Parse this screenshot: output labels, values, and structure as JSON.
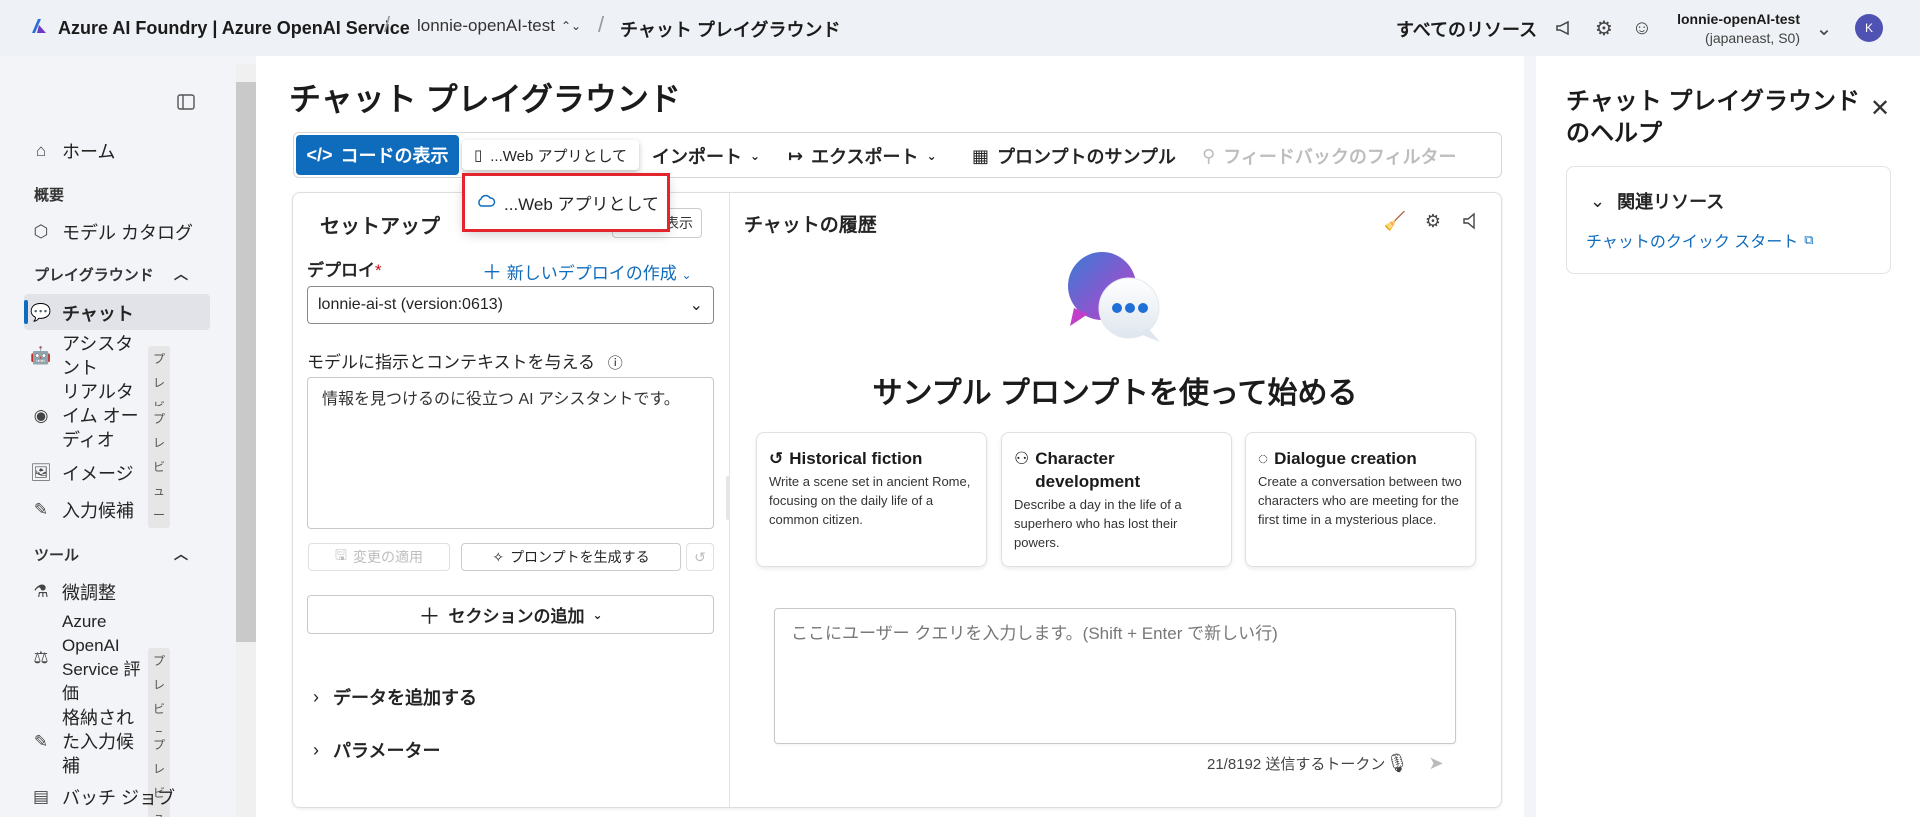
{
  "topbar": {
    "brand": "Azure AI Foundry | Azure OpenAI Service",
    "project": "lonnie-openAI-test",
    "page": "チャット プレイグラウンド",
    "all_resources": "すべてのリソース",
    "account_name": "lonnie-openAI-test",
    "account_region": "(japaneast, S0)",
    "avatar_initial": "K"
  },
  "sidebar": {
    "home": "ホーム",
    "overview_section": "概要",
    "model_catalog": "モデル カタログ",
    "playground_section": "プレイグラウンド",
    "chat": "チャット",
    "assistant": "アシスタ\nント",
    "realtime_audio": "リアルタ\nイム オー\nディオ",
    "image": "イメージ",
    "completions": "入力候補",
    "tools_section": "ツール",
    "fine_tuning": "微調整",
    "evaluation": "Azure\nOpenAI\nService 評\n価",
    "stored_completions": "格納され\nた入力候\n補",
    "batch_jobs": "バッチ ジョブ",
    "preview_badge": "プレビュー"
  },
  "main": {
    "title": "チャット プレイグラウンド",
    "toolbar": {
      "view_code": "コードの表示",
      "deploy_tip": "...Web アプリとして",
      "import": "インポート",
      "export": "エクスポート",
      "prompt_samples": "プロンプトのサンプル",
      "feedback_filter": "フィードバックのフィルター"
    },
    "dropdown_item": "...Web アプリとして",
    "setup": {
      "title": "セットアップ",
      "show_btn": "表示",
      "deploy_label": "デプロイ",
      "required": "*",
      "new_deploy": "新しいデプロイの作成",
      "deploy_value": "lonnie-ai-st (version:0613)",
      "instruct_label": "モデルに指示とコンテキストを与える",
      "system_message": "情報を見つけるのに役立つ AI アシスタントです。",
      "apply_changes": "変更の適用",
      "generate_prompt": "プロンプトを生成する",
      "add_section": "セクションの追加",
      "add_data": "データを追加する",
      "parameters": "パラメーター"
    },
    "history": {
      "title": "チャットの履歴",
      "start_title": "サンプル プロンプトを使って始める",
      "cards": [
        {
          "title": "Historical fiction",
          "desc": "Write a scene set in ancient Rome, focusing on the daily life of a common citizen."
        },
        {
          "title": "Character development",
          "desc": "Describe a day in the life of a superhero who has lost their powers."
        },
        {
          "title": "Dialogue creation",
          "desc": "Create a conversation between two characters who are meeting for the first time in a mysterious place."
        }
      ],
      "query_placeholder": "ここにユーザー クエリを入力します。(Shift + Enter で新しい行)",
      "tokens": "21/8192 送信するトークン"
    }
  },
  "help": {
    "title": "チャット プレイグラウンドのヘルプ",
    "section": "関連リソース",
    "link": "チャットのクイック スタート"
  },
  "colors": {
    "accent": "#0f6cbd",
    "highlight_border": "#e3262e"
  }
}
